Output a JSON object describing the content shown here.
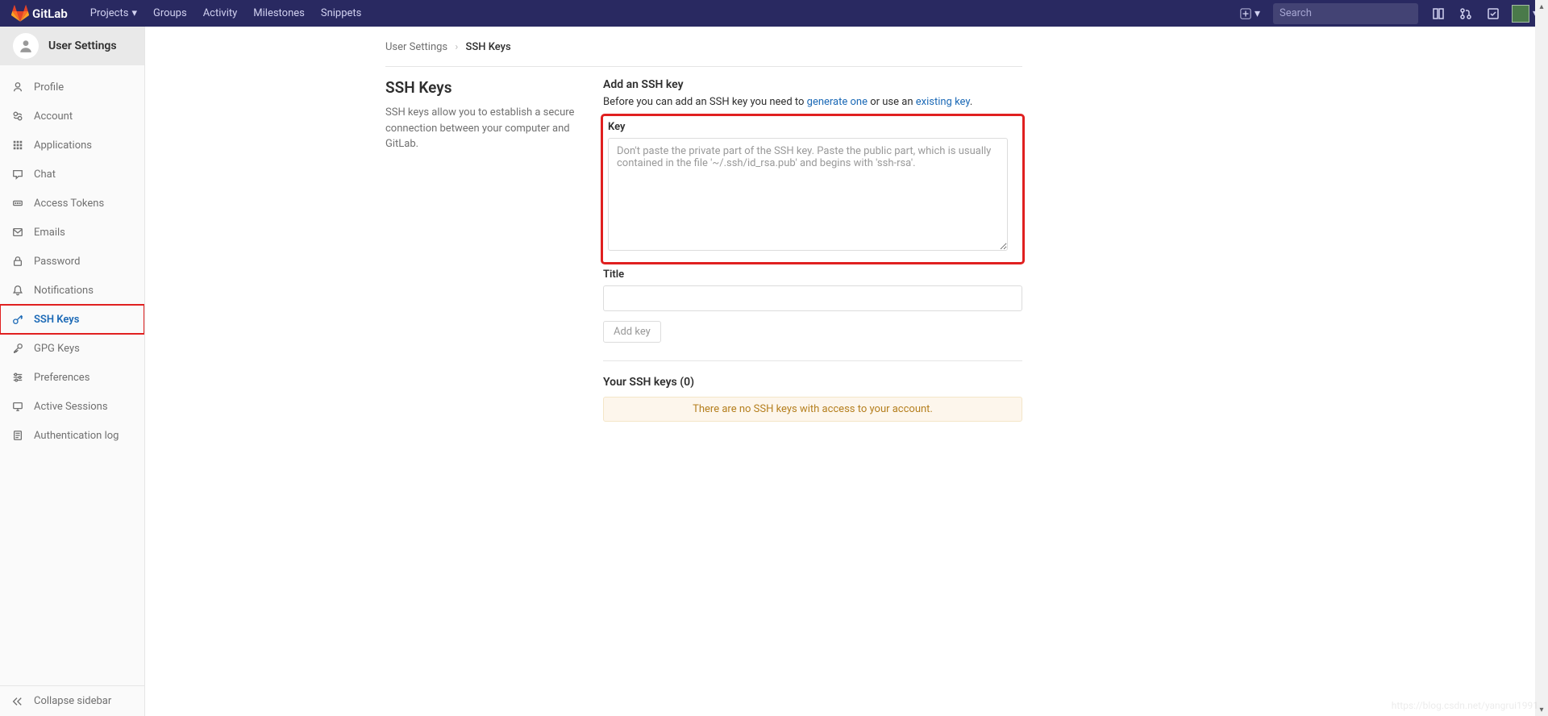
{
  "navbar": {
    "brand": "GitLab",
    "items": [
      "Projects",
      "Groups",
      "Activity",
      "Milestones",
      "Snippets"
    ],
    "search_placeholder": "Search"
  },
  "sidebar": {
    "title": "User Settings",
    "items": [
      {
        "label": "Profile",
        "icon": "user-icon"
      },
      {
        "label": "Account",
        "icon": "account-icon"
      },
      {
        "label": "Applications",
        "icon": "apps-icon"
      },
      {
        "label": "Chat",
        "icon": "chat-icon"
      },
      {
        "label": "Access Tokens",
        "icon": "token-icon"
      },
      {
        "label": "Emails",
        "icon": "mail-icon"
      },
      {
        "label": "Password",
        "icon": "lock-icon"
      },
      {
        "label": "Notifications",
        "icon": "bell-icon"
      },
      {
        "label": "SSH Keys",
        "icon": "key-icon",
        "active": true,
        "highlighted": true
      },
      {
        "label": "GPG Keys",
        "icon": "key2-icon"
      },
      {
        "label": "Preferences",
        "icon": "prefs-icon"
      },
      {
        "label": "Active Sessions",
        "icon": "monitor-icon"
      },
      {
        "label": "Authentication log",
        "icon": "log-icon"
      }
    ],
    "collapse": "Collapse sidebar"
  },
  "breadcrumb": {
    "parent": "User Settings",
    "current": "SSH Keys"
  },
  "page": {
    "heading": "SSH Keys",
    "desc": "SSH keys allow you to establish a secure connection between your computer and GitLab."
  },
  "form": {
    "section_title": "Add an SSH key",
    "intro_pre": "Before you can add an SSH key you need to ",
    "link_generate": "generate one",
    "intro_mid": " or use an ",
    "link_existing": "existing key",
    "intro_post": ".",
    "key_label": "Key",
    "key_placeholder": "Don't paste the private part of the SSH key. Paste the public part, which is usually contained in the file '~/.ssh/id_rsa.pub' and begins with 'ssh-rsa'.",
    "title_label": "Title",
    "add_button": "Add key"
  },
  "keys_list": {
    "heading": "Your SSH keys (0)",
    "empty": "There are no SSH keys with access to your account."
  },
  "watermark": "https://blog.csdn.net/yangrui1991"
}
